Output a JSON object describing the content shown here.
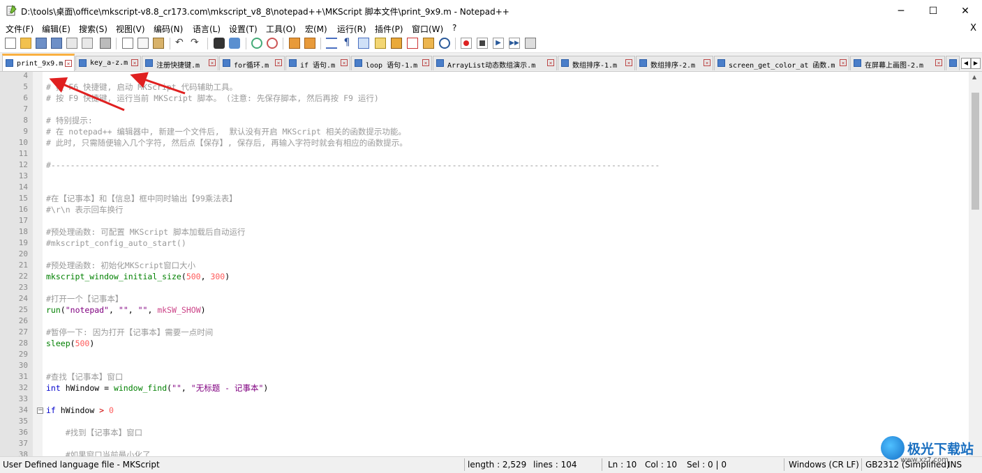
{
  "window": {
    "title": "D:\\tools\\桌面\\office\\mkscript-v8.8_cr173.com\\mkscript_v8_8\\notepad++\\MKScript 脚本文件\\print_9x9.m - Notepad++",
    "minimize": "─",
    "maximize": "☐",
    "close": "✕"
  },
  "menu": {
    "items": [
      "文件(F)",
      "编辑(E)",
      "搜索(S)",
      "视图(V)",
      "编码(N)",
      "语言(L)",
      "设置(T)",
      "工具(O)",
      "宏(M)",
      "运行(R)",
      "插件(P)",
      "窗口(W)",
      "?"
    ],
    "close": "X"
  },
  "tabs": [
    {
      "label": "print_9x9.m",
      "active": true
    },
    {
      "label": "key_a-z.m",
      "active": false
    },
    {
      "label": "注册快捷键.m",
      "active": false
    },
    {
      "label": "for循环.m",
      "active": false
    },
    {
      "label": "if 语句.m",
      "active": false
    },
    {
      "label": "loop 语句-1.m",
      "active": false
    },
    {
      "label": "ArrayList动态数组演示.m",
      "active": false
    },
    {
      "label": "数组排序-1.m",
      "active": false
    },
    {
      "label": "数组排序-2.m",
      "active": false
    },
    {
      "label": "screen_get_color_at 函数.m",
      "active": false
    },
    {
      "label": "在屏幕上画图-2.m",
      "active": false
    }
  ],
  "editor": {
    "lines": [
      {
        "n": "4",
        "c": ""
      },
      {
        "n": "5",
        "c": "# 按 F6 快捷键, 启动 MKScript 代码辅助工具。"
      },
      {
        "n": "6",
        "c": "# 按 F9 快捷键, 运行当前 MKScript 脚本。 (注意: 先保存脚本, 然后再按 F9 运行)"
      },
      {
        "n": "7",
        "c": ""
      },
      {
        "n": "8",
        "c": "# 特别提示:"
      },
      {
        "n": "9",
        "c": "# 在 notepad++ 编辑器中, 新建一个文件后,  默认没有开启 MKScript 相关的函数提示功能。"
      },
      {
        "n": "10",
        "c": "# 此时, 只需随便输入几个字符, 然后点【保存】, 保存后, 再输入字符时就会有相应的函数提示。"
      },
      {
        "n": "11",
        "c": ""
      },
      {
        "n": "12",
        "c": "#------------------------------------------------------------------------------------------------------------------------------"
      },
      {
        "n": "13",
        "c": ""
      },
      {
        "n": "14",
        "c": ""
      },
      {
        "n": "15",
        "c": "#在【记事本】和【信息】框中同时输出【99乘法表】"
      },
      {
        "n": "16",
        "c": "#\\r\\n 表示回车换行"
      },
      {
        "n": "17",
        "c": ""
      },
      {
        "n": "18",
        "c": "#预处理函数: 可配置 MKScript 脚本加载后自动运行"
      },
      {
        "n": "19",
        "c": "#mkscript_config_auto_start()"
      },
      {
        "n": "20",
        "c": ""
      },
      {
        "n": "21",
        "c": "#预处理函数: 初始化MKScript窗口大小"
      },
      {
        "n": "22",
        "c": "mkscript_window_initial_size(500, 300)"
      },
      {
        "n": "23",
        "c": ""
      },
      {
        "n": "24",
        "c": "#打开一个【记事本】"
      },
      {
        "n": "25",
        "c": "run(\"notepad\", \"\", \"\", mkSW_SHOW)"
      },
      {
        "n": "26",
        "c": ""
      },
      {
        "n": "27",
        "c": "#暂停一下: 因为打开【记事本】需要一点时间"
      },
      {
        "n": "28",
        "c": "sleep(500)"
      },
      {
        "n": "29",
        "c": ""
      },
      {
        "n": "30",
        "c": ""
      },
      {
        "n": "31",
        "c": "#查找【记事本】窗口"
      },
      {
        "n": "32",
        "c": "int hWindow = window_find(\"\", \"无标题 - 记事本\")"
      },
      {
        "n": "33",
        "c": ""
      },
      {
        "n": "34",
        "c": "if hWindow > 0"
      },
      {
        "n": "35",
        "c": ""
      },
      {
        "n": "36",
        "c": "    #找到【记事本】窗口"
      },
      {
        "n": "37",
        "c": ""
      },
      {
        "n": "38",
        "c": "    #如果窗口当前最小化了"
      }
    ]
  },
  "status": {
    "language": "User Defined language file - MKScript",
    "length": "length : 2,529",
    "lines": "lines : 104",
    "ln": "Ln : 10",
    "col": "Col : 10",
    "sel": "Sel : 0 | 0",
    "eol": "Windows (CR LF)",
    "encoding": "GB2312 (Simplified)",
    "mode": "INS"
  },
  "watermark": {
    "text": "极光下载站",
    "url": "www.xz7.com"
  },
  "colors": {
    "comment": "#9a9a9a",
    "function": "#008000",
    "number": "#ff5a5a",
    "string": "#800080",
    "keyword": "#0000cc",
    "active_tab_accent": "#fab040",
    "annotation_arrow": "#e02020"
  }
}
